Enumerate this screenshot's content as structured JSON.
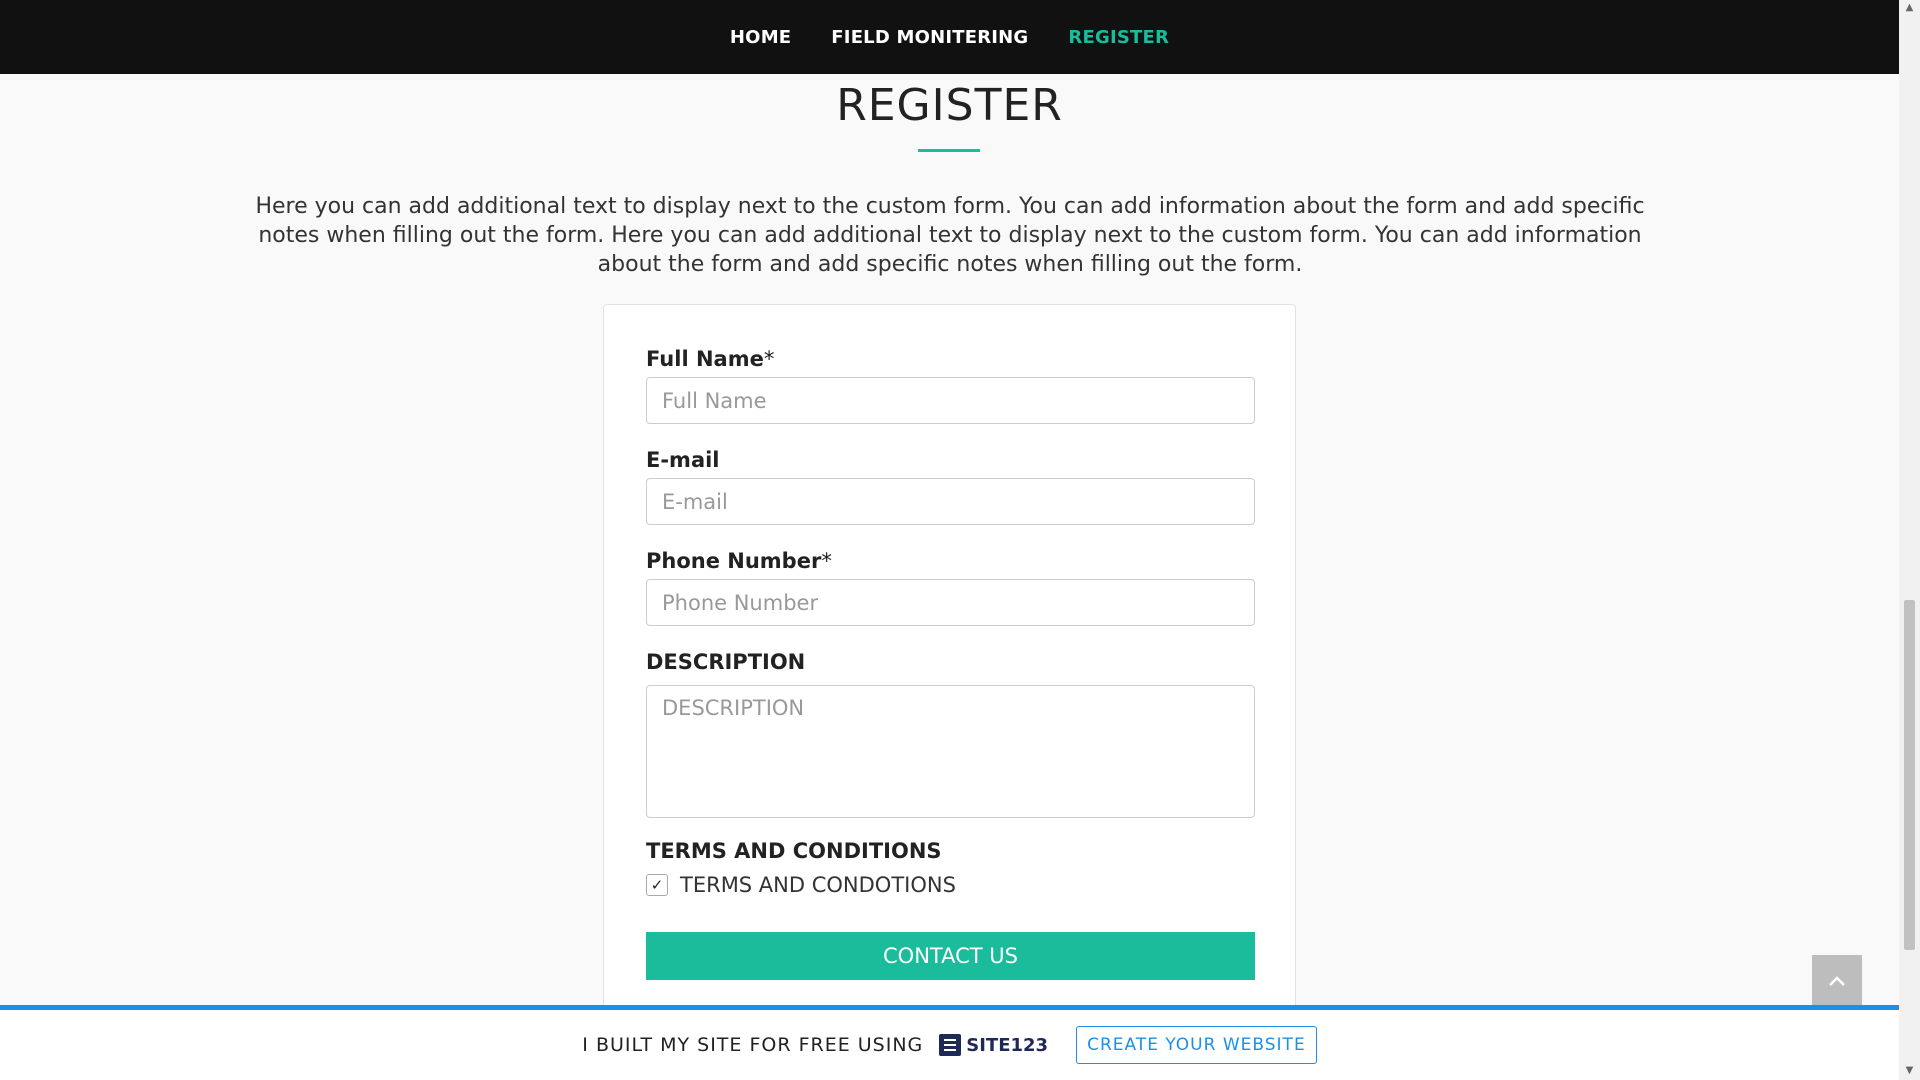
{
  "nav": {
    "items": [
      {
        "label": "HOME"
      },
      {
        "label": "FIELD MONITERING"
      },
      {
        "label": "REGISTER"
      }
    ]
  },
  "page": {
    "title": "REGISTER",
    "intro": "Here you can add additional text to display next to the custom form. You can add information about the form and add specific notes when filling out the form. Here you can add additional text to display next to the custom form. You can add information about the form and add specific notes when filling out the form."
  },
  "form": {
    "full_name": {
      "label": "Full Name",
      "required_mark": "*",
      "placeholder": "Full Name"
    },
    "email": {
      "label": "E-mail",
      "placeholder": "E-mail"
    },
    "phone": {
      "label": "Phone Number",
      "required_mark": "*",
      "placeholder": "Phone Number"
    },
    "description": {
      "label": "DESCRIPTION",
      "placeholder": "DESCRIPTION"
    },
    "terms": {
      "heading": "TERMS AND CONDITIONS",
      "checkbox_label": "TERMS AND CONDOTIONS",
      "checked": true,
      "check_glyph": "✓"
    },
    "submit_label": "CONTACT US"
  },
  "back_to_top": {
    "icon": "chevron-up-icon",
    "glyph": "︿"
  },
  "footer": {
    "text": "I BUILT MY SITE FOR FREE USING",
    "brand": "SITE123",
    "cta": "CREATE YOUR WEBSITE"
  },
  "colors": {
    "accent": "#1abc9c",
    "footer_accent": "#1e8fe6",
    "navbar": "#111111"
  }
}
